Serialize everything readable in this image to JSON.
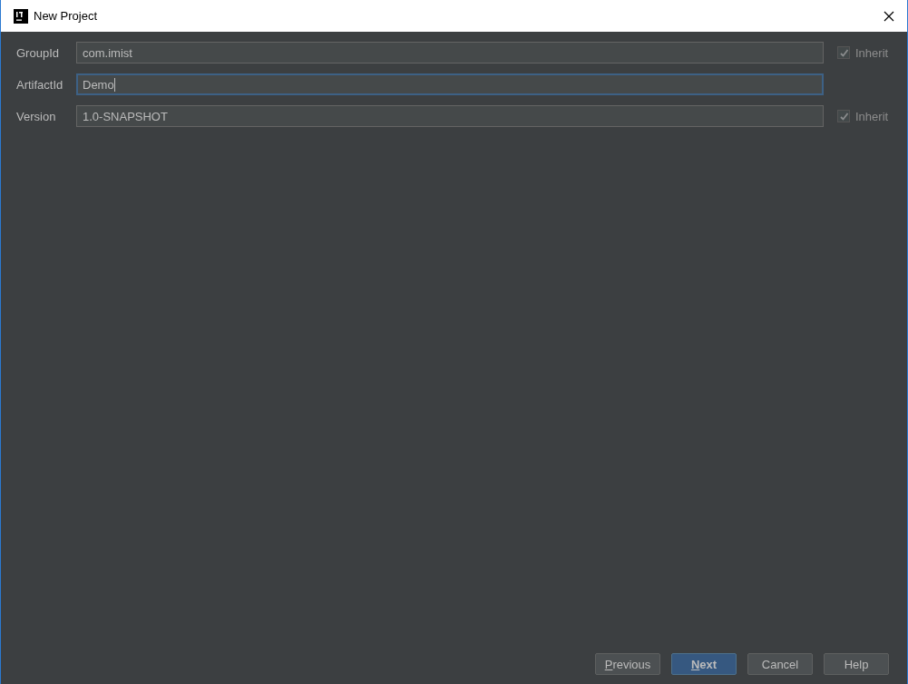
{
  "window": {
    "title": "New Project"
  },
  "fields": [
    {
      "label": "GroupId",
      "value": "com.imist",
      "focused": false,
      "inherit": {
        "label": "Inherit",
        "checked": true,
        "disabled": true
      }
    },
    {
      "label": "ArtifactId",
      "value": "Demo",
      "focused": true
    },
    {
      "label": "Version",
      "value": "1.0-SNAPSHOT",
      "focused": false,
      "inherit": {
        "label": "Inherit",
        "checked": true,
        "disabled": true
      }
    }
  ],
  "buttons": [
    {
      "label": "Previous",
      "default": false,
      "mnemonic": true
    },
    {
      "label": "Next",
      "default": true,
      "mnemonic": true
    },
    {
      "label": "Cancel",
      "default": false,
      "mnemonic": false
    },
    {
      "label": "Help",
      "default": false,
      "mnemonic": false
    }
  ]
}
